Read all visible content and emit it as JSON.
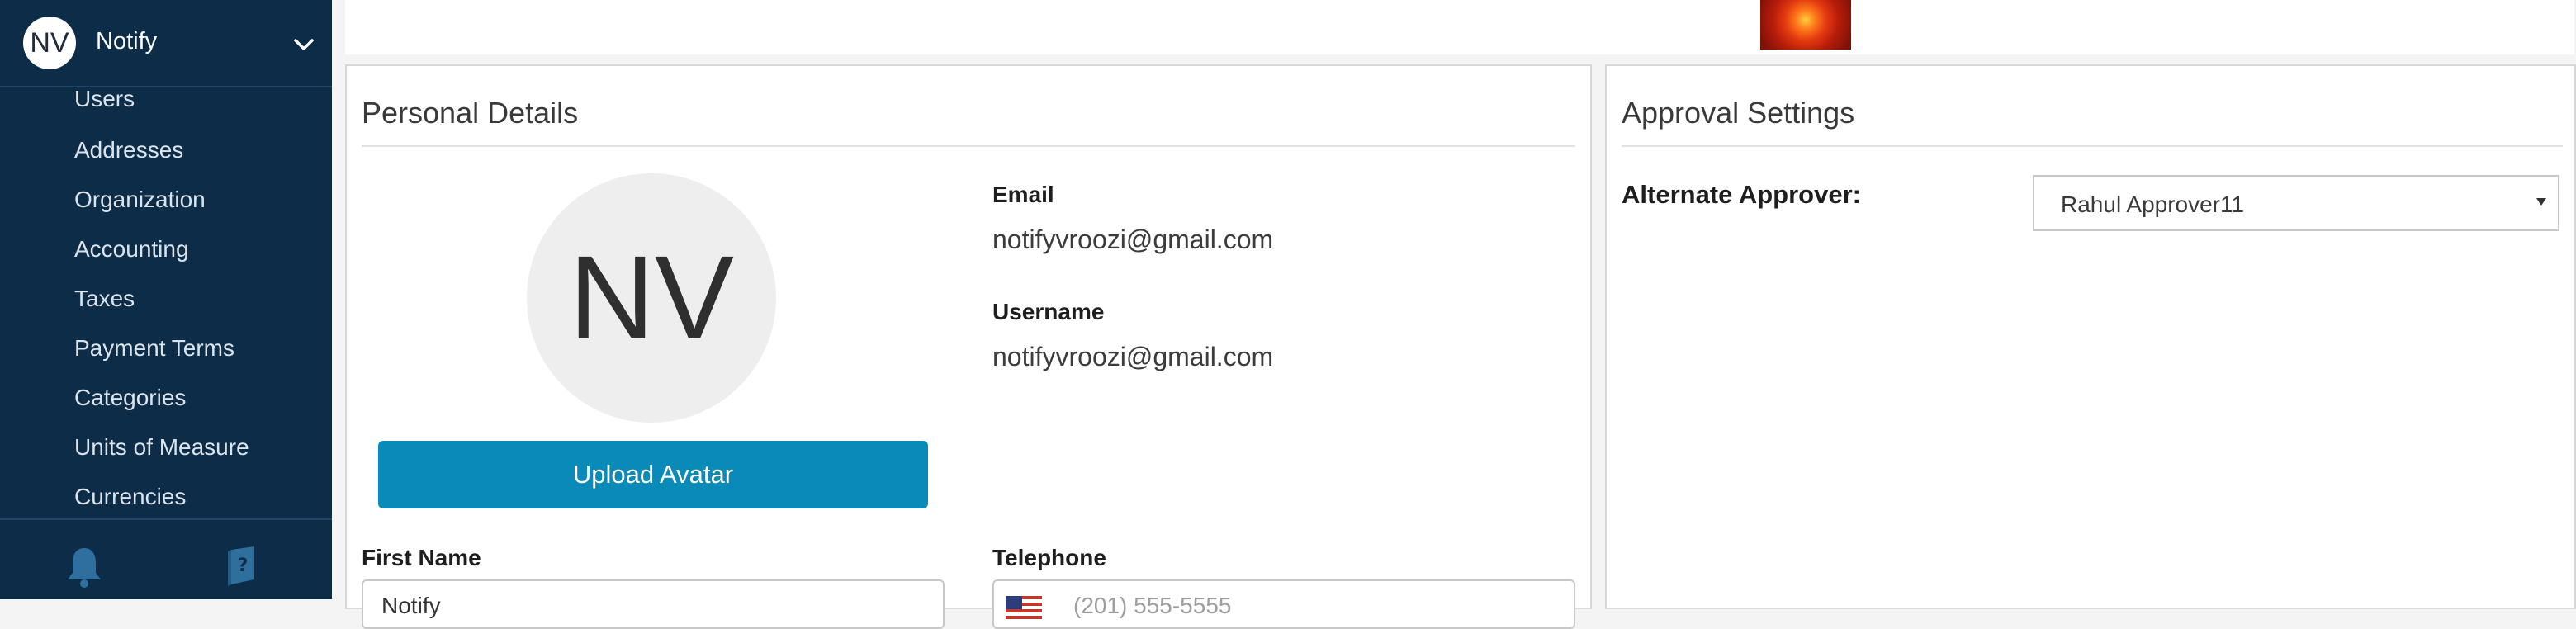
{
  "sidebar": {
    "avatar_initials": "NV",
    "user_name": "Notify",
    "nav_items": [
      "Users",
      "Addresses",
      "Organization",
      "Accounting",
      "Taxes",
      "Payment Terms",
      "Categories",
      "Units of Measure",
      "Currencies"
    ],
    "footer_icons": [
      "bell-icon",
      "help-book-icon"
    ]
  },
  "personal": {
    "title": "Personal Details",
    "avatar_initials": "NV",
    "upload_label": "Upload Avatar",
    "email_label": "Email",
    "email_value": "notifyvroozi@gmail.com",
    "username_label": "Username",
    "username_value": "notifyvroozi@gmail.com",
    "first_name_label": "First Name",
    "first_name_value": "Notify",
    "telephone_label": "Telephone",
    "telephone_placeholder": "(201) 555-5555"
  },
  "approval": {
    "title": "Approval Settings",
    "alt_approver_label": "Alternate Approver:",
    "alt_approver_value": "Rahul Approver11"
  },
  "colors": {
    "sidebar_bg": "#0c2c48",
    "primary_button": "#0a8ab8"
  }
}
